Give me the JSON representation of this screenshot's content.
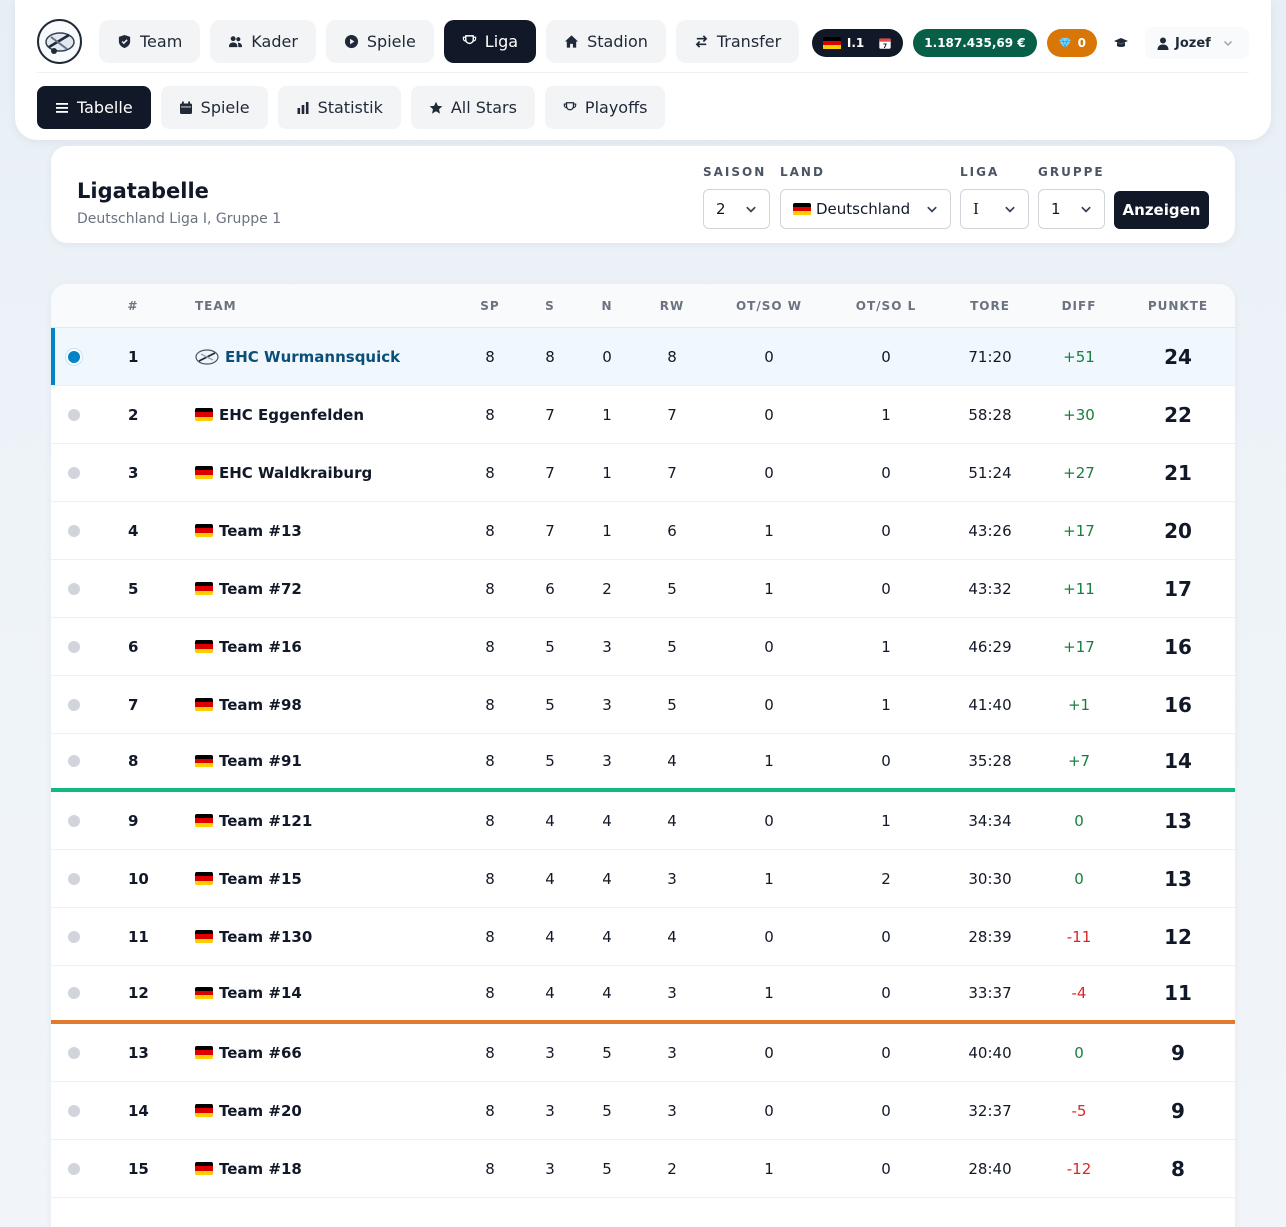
{
  "nav": {
    "tabs": [
      {
        "label": "Team",
        "icon": "shield-icon"
      },
      {
        "label": "Kader",
        "icon": "users-icon"
      },
      {
        "label": "Spiele",
        "icon": "play-icon"
      },
      {
        "label": "Liga",
        "icon": "trophy-icon",
        "active": true
      },
      {
        "label": "Stadion",
        "icon": "home-icon"
      },
      {
        "label": "Transfer",
        "icon": "transfer-icon"
      }
    ],
    "league_badge": "I.1",
    "balance": "1.187.435,69 €",
    "diamonds": "0",
    "user": "Jozef"
  },
  "subnav": {
    "tabs": [
      {
        "label": "Tabelle",
        "icon": "list-icon",
        "active": true
      },
      {
        "label": "Spiele",
        "icon": "calendar-icon"
      },
      {
        "label": "Statistik",
        "icon": "bar-chart-icon"
      },
      {
        "label": "All Stars",
        "icon": "star-icon"
      },
      {
        "label": "Playoffs",
        "icon": "trophy-icon"
      }
    ]
  },
  "filter": {
    "title": "Ligatabelle",
    "subtitle": "Deutschland Liga I, Gruppe 1",
    "saison_label": "SAISON",
    "saison_value": "2",
    "land_label": "LAND",
    "land_value": "Deutschland",
    "liga_label": "LIGA",
    "liga_value": "I",
    "gruppe_label": "GRUPPE",
    "gruppe_value": "1",
    "button": "Anzeigen"
  },
  "table": {
    "headers": {
      "rank": "#",
      "team": "TEAM",
      "sp": "SP",
      "s": "S",
      "n": "N",
      "rw": "RW",
      "otw": "OT/SO W",
      "otl": "OT/SO L",
      "tore": "TORE",
      "diff": "DIFF",
      "punkte": "PUNKTE"
    },
    "rows": [
      {
        "rank": "1",
        "team": "EHC Wurmannsquick",
        "sp": "8",
        "s": "8",
        "n": "0",
        "rw": "8",
        "otw": "0",
        "otl": "0",
        "tore": "71:20",
        "diff": "+51",
        "pts": "24"
      },
      {
        "rank": "2",
        "team": "EHC Eggenfelden",
        "sp": "8",
        "s": "7",
        "n": "1",
        "rw": "7",
        "otw": "0",
        "otl": "1",
        "tore": "58:28",
        "diff": "+30",
        "pts": "22"
      },
      {
        "rank": "3",
        "team": "EHC Waldkraiburg",
        "sp": "8",
        "s": "7",
        "n": "1",
        "rw": "7",
        "otw": "0",
        "otl": "0",
        "tore": "51:24",
        "diff": "+27",
        "pts": "21"
      },
      {
        "rank": "4",
        "team": "Team #13",
        "sp": "8",
        "s": "7",
        "n": "1",
        "rw": "6",
        "otw": "1",
        "otl": "0",
        "tore": "43:26",
        "diff": "+17",
        "pts": "20"
      },
      {
        "rank": "5",
        "team": "Team #72",
        "sp": "8",
        "s": "6",
        "n": "2",
        "rw": "5",
        "otw": "1",
        "otl": "0",
        "tore": "43:32",
        "diff": "+11",
        "pts": "17"
      },
      {
        "rank": "6",
        "team": "Team #16",
        "sp": "8",
        "s": "5",
        "n": "3",
        "rw": "5",
        "otw": "0",
        "otl": "1",
        "tore": "46:29",
        "diff": "+17",
        "pts": "16"
      },
      {
        "rank": "7",
        "team": "Team #98",
        "sp": "8",
        "s": "5",
        "n": "3",
        "rw": "5",
        "otw": "0",
        "otl": "1",
        "tore": "41:40",
        "diff": "+1",
        "pts": "16"
      },
      {
        "rank": "8",
        "team": "Team #91",
        "sp": "8",
        "s": "5",
        "n": "3",
        "rw": "4",
        "otw": "1",
        "otl": "0",
        "tore": "35:28",
        "diff": "+7",
        "pts": "14"
      },
      {
        "rank": "9",
        "team": "Team #121",
        "sp": "8",
        "s": "4",
        "n": "4",
        "rw": "4",
        "otw": "0",
        "otl": "1",
        "tore": "34:34",
        "diff": "0",
        "pts": "13"
      },
      {
        "rank": "10",
        "team": "Team #15",
        "sp": "8",
        "s": "4",
        "n": "4",
        "rw": "3",
        "otw": "1",
        "otl": "2",
        "tore": "30:30",
        "diff": "0",
        "pts": "13"
      },
      {
        "rank": "11",
        "team": "Team #130",
        "sp": "8",
        "s": "4",
        "n": "4",
        "rw": "4",
        "otw": "0",
        "otl": "0",
        "tore": "28:39",
        "diff": "-11",
        "pts": "12"
      },
      {
        "rank": "12",
        "team": "Team #14",
        "sp": "8",
        "s": "4",
        "n": "4",
        "rw": "3",
        "otw": "1",
        "otl": "0",
        "tore": "33:37",
        "diff": "-4",
        "pts": "11"
      },
      {
        "rank": "13",
        "team": "Team #66",
        "sp": "8",
        "s": "3",
        "n": "5",
        "rw": "3",
        "otw": "0",
        "otl": "0",
        "tore": "40:40",
        "diff": "0",
        "pts": "9"
      },
      {
        "rank": "14",
        "team": "Team #20",
        "sp": "8",
        "s": "3",
        "n": "5",
        "rw": "3",
        "otw": "0",
        "otl": "0",
        "tore": "32:37",
        "diff": "-5",
        "pts": "9"
      },
      {
        "rank": "15",
        "team": "Team #18",
        "sp": "8",
        "s": "3",
        "n": "5",
        "rw": "2",
        "otw": "1",
        "otl": "0",
        "tore": "28:40",
        "diff": "-12",
        "pts": "8"
      }
    ]
  },
  "colors": {
    "dark": "#111827",
    "balance_green": "#065f46",
    "diamond_orange": "#d97706",
    "highlight_blue": "#0284c7",
    "playoff_line": "#10b981",
    "relegation_line": "#e07a2e",
    "positive": "#15803d",
    "negative": "#dc2626"
  }
}
